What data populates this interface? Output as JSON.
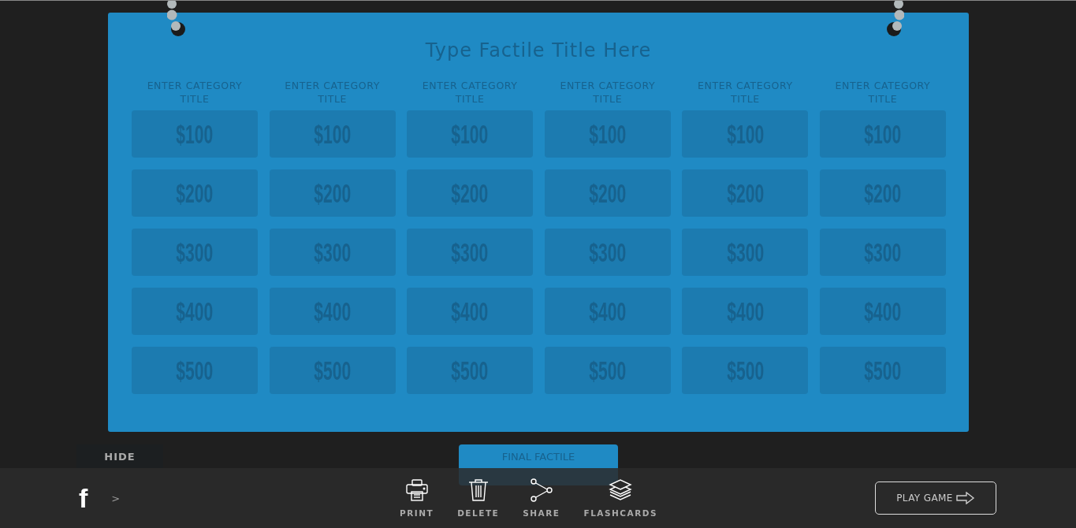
{
  "board": {
    "title": "Type Factile Title Here",
    "columns": [
      {
        "title": "ENTER CATEGORY TITLE",
        "cells": [
          "$100",
          "$200",
          "$300",
          "$400",
          "$500"
        ]
      },
      {
        "title": "ENTER CATEGORY TITLE",
        "cells": [
          "$100",
          "$200",
          "$300",
          "$400",
          "$500"
        ]
      },
      {
        "title": "ENTER CATEGORY TITLE",
        "cells": [
          "$100",
          "$200",
          "$300",
          "$400",
          "$500"
        ]
      },
      {
        "title": "ENTER CATEGORY TITLE",
        "cells": [
          "$100",
          "$200",
          "$300",
          "$400",
          "$500"
        ]
      },
      {
        "title": "ENTER CATEGORY TITLE",
        "cells": [
          "$100",
          "$200",
          "$300",
          "$400",
          "$500"
        ]
      },
      {
        "title": "ENTER CATEGORY TITLE",
        "cells": [
          "$100",
          "$200",
          "$300",
          "$400",
          "$500"
        ]
      }
    ]
  },
  "hide_tab": "HIDE",
  "final_button": "FINAL FACTILE",
  "footer": {
    "social_logo": "f",
    "social_arrow": ">",
    "actions": [
      {
        "kind": "print",
        "label": "PRINT"
      },
      {
        "kind": "delete",
        "label": "DELETE"
      },
      {
        "kind": "share",
        "label": "SHARE"
      },
      {
        "kind": "flashcards",
        "label": "FLASHCARDS"
      }
    ],
    "play_button": "PLAY GAME"
  }
}
